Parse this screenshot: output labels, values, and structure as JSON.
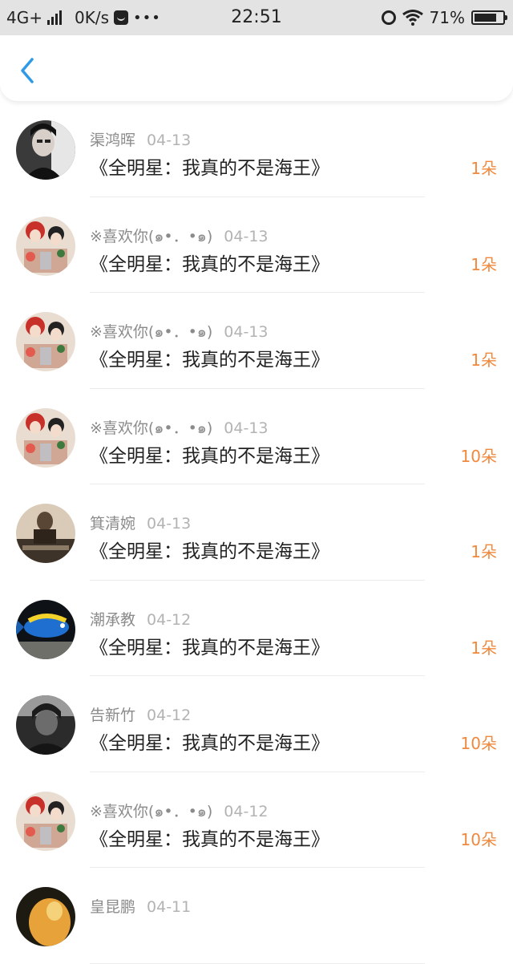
{
  "status_bar": {
    "network": "4G+",
    "speed": "0K/s",
    "dots": "•••",
    "time": "22:51",
    "battery": "71%",
    "icons": [
      "signal-icon",
      "notification-badge-icon",
      "alarm-icon",
      "wifi-icon",
      "battery-icon"
    ]
  },
  "nav": {
    "back_icon": "chevron-left-icon",
    "accent": "#2f9be6"
  },
  "colors": {
    "count": "#f0893e",
    "name": "#8b8b8b",
    "date": "#b3b3b3"
  },
  "rows": [
    {
      "name": "渠鸿晖",
      "date": "04-13",
      "title": "《全明星：我真的不是海王》",
      "count": "1朵",
      "avatar": "avatar-portrait-dark"
    },
    {
      "name": "※喜欢你(๑•．•๑)",
      "date": "04-13",
      "title": "《全明星：我真的不是海王》",
      "count": "1朵",
      "avatar": "avatar-anime"
    },
    {
      "name": "※喜欢你(๑•．•๑)",
      "date": "04-13",
      "title": "《全明星：我真的不是海王》",
      "count": "1朵",
      "avatar": "avatar-anime"
    },
    {
      "name": "※喜欢你(๑•．•๑)",
      "date": "04-13",
      "title": "《全明星：我真的不是海王》",
      "count": "10朵",
      "avatar": "avatar-anime"
    },
    {
      "name": "箕清婉",
      "date": "04-13",
      "title": "《全明星：我真的不是海王》",
      "count": "1朵",
      "avatar": "avatar-photo-sepia"
    },
    {
      "name": "潮承教",
      "date": "04-12",
      "title": "《全明星：我真的不是海王》",
      "count": "1朵",
      "avatar": "avatar-fish"
    },
    {
      "name": "告新竹",
      "date": "04-12",
      "title": "《全明星：我真的不是海王》",
      "count": "10朵",
      "avatar": "avatar-portrait-gray"
    },
    {
      "name": "※喜欢你(๑•．•๑)",
      "date": "04-12",
      "title": "《全明星：我真的不是海王》",
      "count": "10朵",
      "avatar": "avatar-anime"
    },
    {
      "name": "皇昆鹏",
      "date": "04-11",
      "title": "",
      "count": "",
      "avatar": "avatar-orange"
    }
  ]
}
